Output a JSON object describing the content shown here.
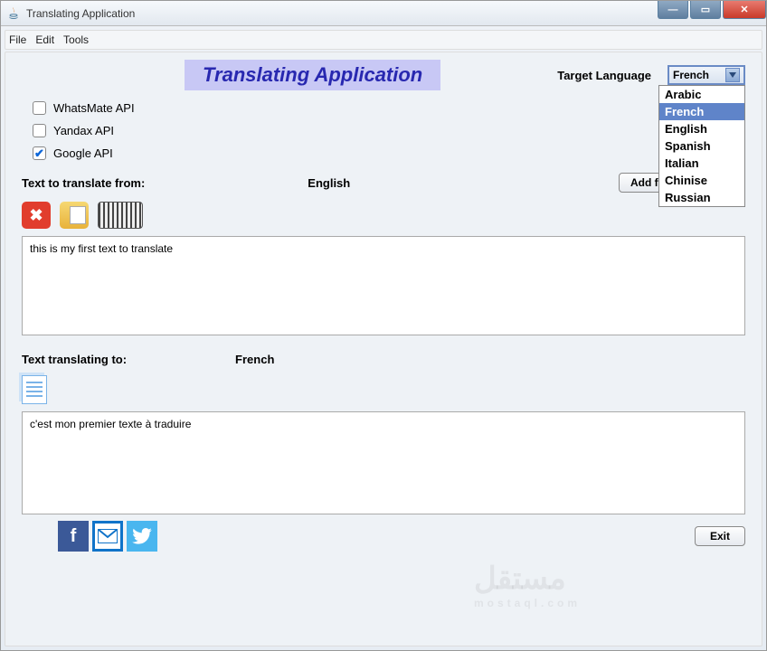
{
  "window": {
    "title": "Translating Application"
  },
  "menu": {
    "file": "File",
    "edit": "Edit",
    "tools": "Tools"
  },
  "header": {
    "app_title": "Translating Application",
    "target_lang_label": "Target Language",
    "selected_lang": "French"
  },
  "dropdown": {
    "options": [
      "Arabic",
      "French",
      "English",
      "Spanish",
      "Italian",
      "Chinise",
      "Russian"
    ],
    "selected_index": 1
  },
  "apis": {
    "whatsmate": {
      "label": "WhatsMate API",
      "checked": false
    },
    "yandax": {
      "label": "Yandax API",
      "checked": false
    },
    "google": {
      "label": "Google API",
      "checked": true
    }
  },
  "source": {
    "label": "Text to translate from:",
    "lang": "English",
    "add_file": "Add file",
    "save": "Save",
    "text": "this is my first text to translate"
  },
  "target": {
    "label": "Text translating to:",
    "lang": "French",
    "text": "c'est mon premier texte à traduire"
  },
  "footer": {
    "exit": "Exit"
  },
  "watermark": {
    "main": "مستقل",
    "sub": "mostaql.com"
  }
}
